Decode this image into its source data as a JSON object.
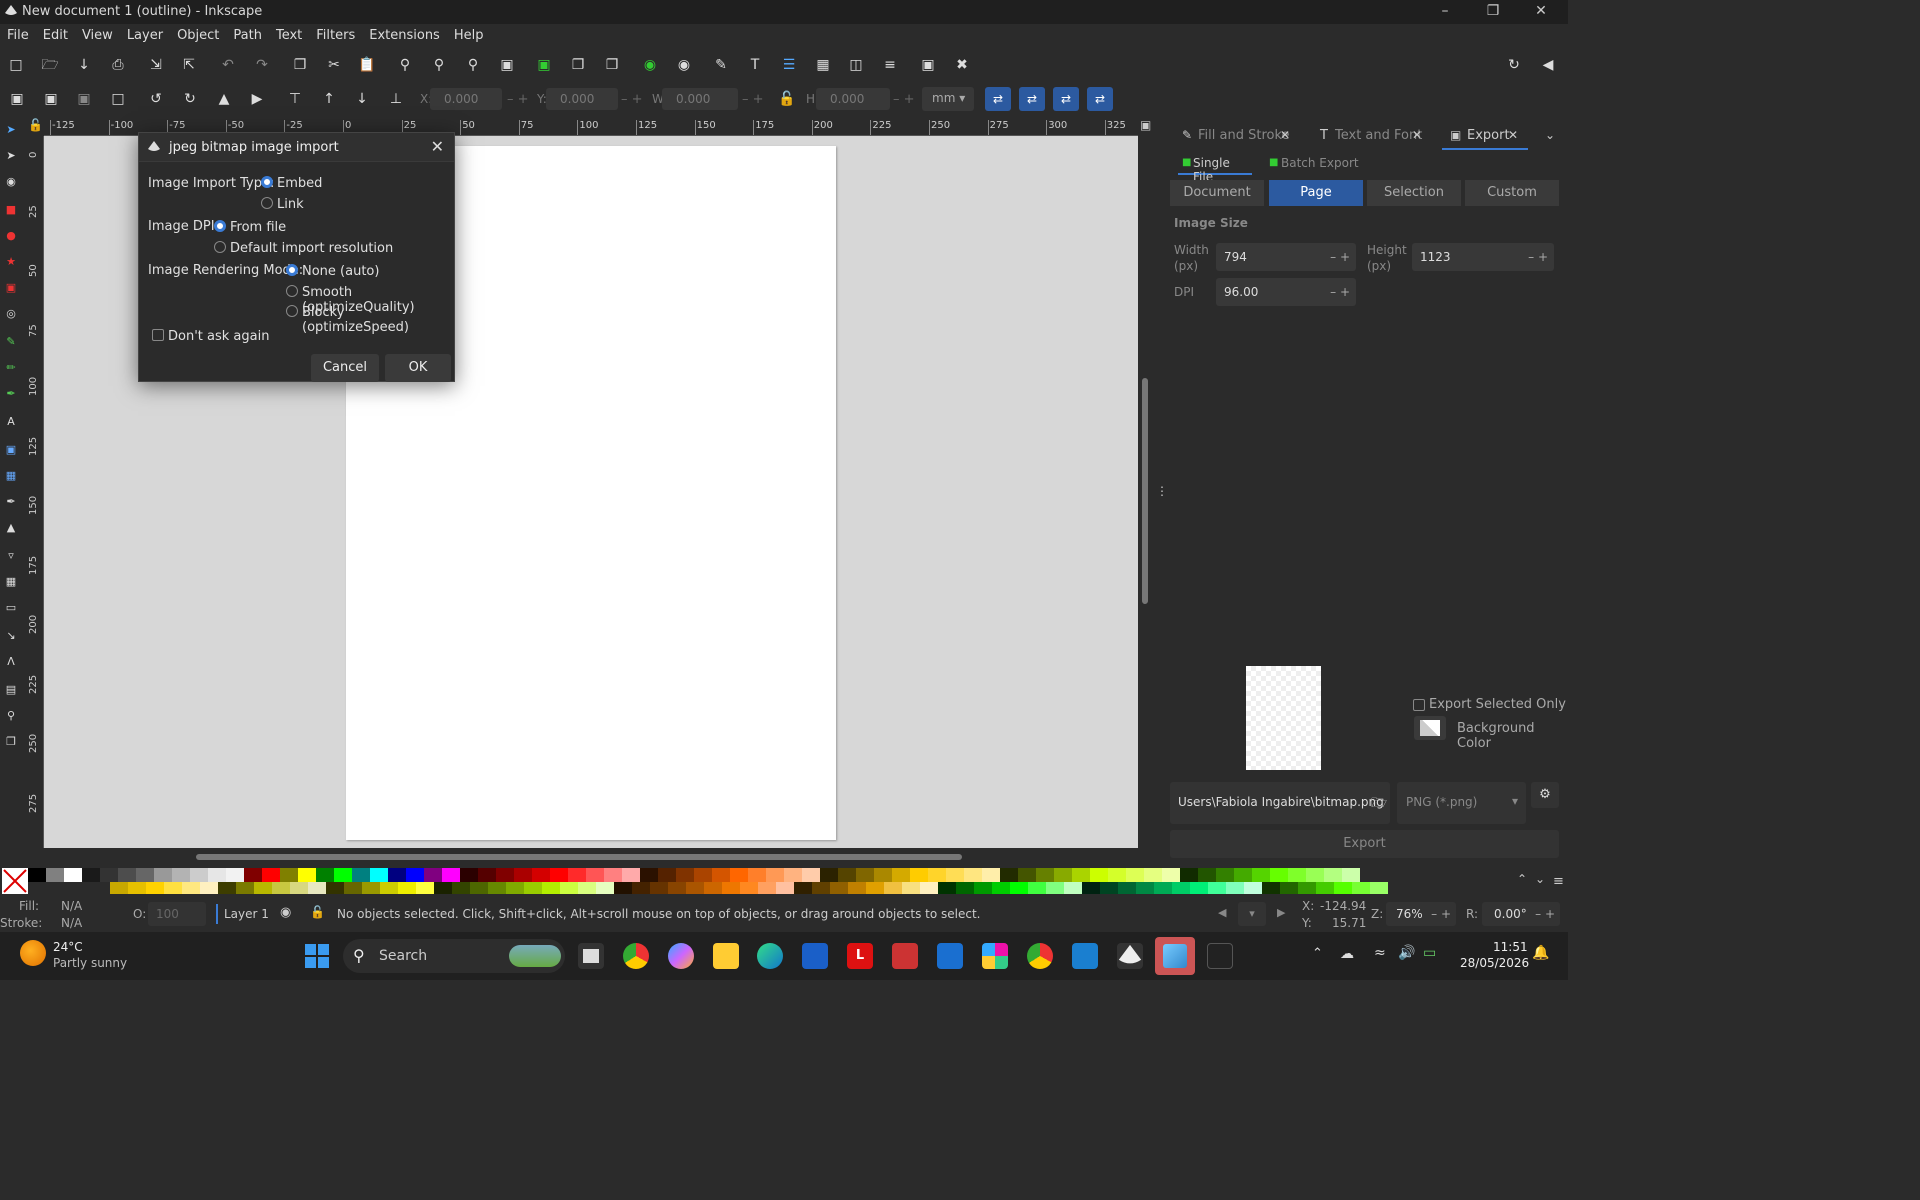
{
  "window": {
    "title": "New document 1 (outline) - Inkscape"
  },
  "menu": [
    "File",
    "Edit",
    "View",
    "Layer",
    "Object",
    "Path",
    "Text",
    "Filters",
    "Extensions",
    "Help"
  ],
  "coords": {
    "x_label": "X:",
    "x": "0.000",
    "y_label": "Y:",
    "y": "0.000",
    "w_label": "W:",
    "w": "0.000",
    "h_label": "H:",
    "h": "0.000",
    "unit": "mm"
  },
  "ruler_top": [
    "-125",
    "-100",
    "-75",
    "-50",
    "-25",
    "0",
    "25",
    "50",
    "75",
    "100",
    "125",
    "150",
    "175",
    "200",
    "225",
    "250",
    "275",
    "300",
    "325"
  ],
  "ruler_left": [
    "0",
    "25",
    "50",
    "75",
    "100",
    "125",
    "150",
    "175",
    "200",
    "225",
    "250",
    "275"
  ],
  "dialog": {
    "title": "jpeg bitmap image import",
    "import_type_label": "Image Import Type:",
    "embed": "Embed",
    "link": "Link",
    "dpi_label": "Image DPI:",
    "from_file": "From file",
    "default_res": "Default import resolution",
    "rendering_label": "Image Rendering Mode:",
    "none_auto": "None (auto)",
    "smooth": "Smooth (optimizeQuality)",
    "blocky": "Blocky (optimizeSpeed)",
    "dont_ask": "Don't ask again",
    "cancel": "Cancel",
    "ok": "OK"
  },
  "panel": {
    "tabs": [
      "Fill and Stroke",
      "Text and Font",
      "Export"
    ],
    "single_file": "Single File",
    "batch_export": "Batch Export",
    "segments": [
      "Document",
      "Page",
      "Selection",
      "Custom"
    ],
    "image_size": "Image Size",
    "width_label": "Width (px)",
    "width": "794",
    "height_label": "Height (px)",
    "height": "1123",
    "dpi_label": "DPI",
    "dpi": "96.00",
    "export_selected_only": "Export Selected Only",
    "background_color": "Background Color",
    "filename": "Users\\Fabiola Ingabire\\bitmap.png",
    "format": "PNG (*.png)",
    "export_button": "Export"
  },
  "status": {
    "fill_label": "Fill:",
    "fill": "N/A",
    "stroke_label": "Stroke:",
    "stroke": "N/A",
    "opacity_label": "O:",
    "opacity": "100",
    "layer": "Layer 1",
    "message": "No objects selected. Click, Shift+click, Alt+scroll mouse on top of objects, or drag around objects to select.",
    "x_label": "X:",
    "x": "-124.94",
    "y_label": "Y:",
    "y": "15.71",
    "zoom_label": "Z:",
    "zoom": "76%",
    "rotate_label": "R:",
    "rotate": "0.00°"
  },
  "taskbar": {
    "temperature": "24°C",
    "weather": "Partly sunny",
    "search": "Search",
    "time": "11:51",
    "date": "28/05/2026"
  },
  "palette_colors_top": [
    "#000000",
    "#808080",
    "#ffffff",
    "#1a1a1a",
    "#333333",
    "#4d4d4d",
    "#666666",
    "#999999",
    "#b3b3b3",
    "#cccccc",
    "#e6e6e6",
    "#f2f2f2",
    "#800000",
    "#ff0000",
    "#808000",
    "#ffff00",
    "#008000",
    "#00ff00",
    "#008080",
    "#00ffff",
    "#000080",
    "#0000ff",
    "#800080",
    "#ff00ff",
    "#2b0000",
    "#550000",
    "#800000",
    "#aa0000",
    "#d40000",
    "#ff0000",
    "#ff2a2a",
    "#ff5555",
    "#ff8080",
    "#ffaaaa",
    "#2b1100",
    "#552200",
    "#803300",
    "#aa4400",
    "#d45500",
    "#ff6600",
    "#ff7f2a",
    "#ff9955",
    "#ffb380",
    "#ffccaa",
    "#2b2200",
    "#554400",
    "#806600",
    "#aa8800",
    "#d4aa00",
    "#ffcc00",
    "#ffd42a",
    "#ffdd55",
    "#ffe680",
    "#ffeeaa",
    "#222b00",
    "#445500",
    "#668000",
    "#88aa00",
    "#aad400",
    "#ccff00",
    "#d4ff2a",
    "#ddff55",
    "#e5ff80",
    "#eeffaa",
    "#112b00",
    "#225500",
    "#338000",
    "#44aa00",
    "#55d400",
    "#66ff00",
    "#7fff2a",
    "#99ff55",
    "#b3ff80",
    "#ccffaa"
  ],
  "palette_colors_bottom": [
    "#c8a800",
    "#e6c000",
    "#ffd200",
    "#ffe040",
    "#ffe880",
    "#fff0c0",
    "#3d3d00",
    "#7a7a00",
    "#b8b800",
    "#c8c840",
    "#d8d880",
    "#e8e8c0",
    "#333300",
    "#666600",
    "#999900",
    "#cccc00",
    "#eeee00",
    "#ffff40",
    "#1a2200",
    "#334400",
    "#4d6600",
    "#668800",
    "#80aa00",
    "#99cc00",
    "#b3ee00",
    "#ccff40",
    "#d9ff80",
    "#e6ffc0",
    "#221100",
    "#442200",
    "#663300",
    "#884400",
    "#aa5500",
    "#cc6600",
    "#ee7700",
    "#ff8820",
    "#ffa060",
    "#ffc0a0",
    "#302000",
    "#604000",
    "#906000",
    "#c08000",
    "#e0a000",
    "#f0c040",
    "#f8e080",
    "#fff0c0",
    "#003300",
    "#006600",
    "#009900",
    "#00cc00",
    "#00ff00",
    "#40ff40",
    "#80ff80",
    "#c0ffc0",
    "#002211",
    "#004422",
    "#006633",
    "#008844",
    "#00aa55",
    "#00cc66",
    "#00ee77",
    "#40ff99",
    "#80ffbb",
    "#c0ffdd",
    "#113300",
    "#226600",
    "#339900",
    "#44cc00",
    "#55ff00",
    "#77ff33",
    "#99ff66"
  ]
}
